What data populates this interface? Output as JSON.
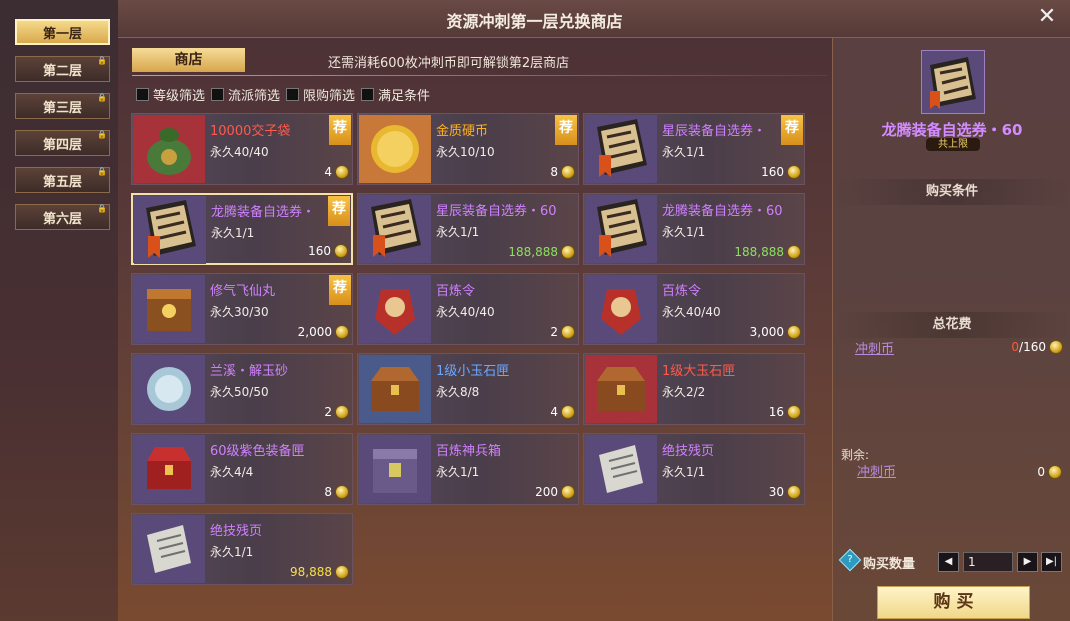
{
  "header": {
    "title": "资源冲刺第一层兑换商店",
    "close_icon": "✕"
  },
  "floors": [
    {
      "label": "第一层",
      "active": true,
      "locked": false
    },
    {
      "label": "第二层",
      "active": false,
      "locked": true
    },
    {
      "label": "第三层",
      "active": false,
      "locked": true
    },
    {
      "label": "第四层",
      "active": false,
      "locked": true
    },
    {
      "label": "第五层",
      "active": false,
      "locked": true
    },
    {
      "label": "第六层",
      "active": false,
      "locked": true
    }
  ],
  "shop": {
    "tab_label": "商店",
    "unlock_note": "还需消耗600枚冲刺币即可解锁第2层商店",
    "filters": [
      "等级筛选",
      "流派筛选",
      "限购筛选",
      "满足条件"
    ]
  },
  "recommend_label": "荐",
  "items": [
    {
      "name": "10000交子袋",
      "limit": "永久40/40",
      "price": "4",
      "name_color": "#ff5a4a",
      "recommended": true,
      "icon": "coin-bag-icon"
    },
    {
      "name": "金质硬币",
      "limit": "永久10/10",
      "price": "8",
      "name_color": "#ffb020",
      "recommended": true,
      "icon": "gold-coin-icon"
    },
    {
      "name": "星辰装备自选券・",
      "limit": "永久1/1",
      "price": "160",
      "name_color": "#d080ff",
      "recommended": true,
      "icon": "voucher-star-icon"
    },
    {
      "name": "龙腾装备自选券・",
      "limit": "永久1/1",
      "price": "160",
      "name_color": "#d080ff",
      "recommended": true,
      "icon": "voucher-dragon-icon",
      "selected": true
    },
    {
      "name": "星辰装备自选券・60",
      "limit": "永久1/1",
      "price": "188,888",
      "name_color": "#d080ff",
      "recommended": false,
      "icon": "voucher-star-icon",
      "price_color": "green"
    },
    {
      "name": "龙腾装备自选券・60",
      "limit": "永久1/1",
      "price": "188,888",
      "name_color": "#d080ff",
      "recommended": false,
      "icon": "voucher-dragon-icon",
      "price_color": "green"
    },
    {
      "name": "修气飞仙丸",
      "limit": "永久30/30",
      "price": "2,000",
      "name_color": "#d080ff",
      "recommended": true,
      "icon": "pill-box-icon"
    },
    {
      "name": "百炼令",
      "limit": "永久40/40",
      "price": "2",
      "name_color": "#d080ff",
      "recommended": false,
      "icon": "token-icon"
    },
    {
      "name": "百炼令",
      "limit": "永久40/40",
      "price": "3,000",
      "name_color": "#d080ff",
      "recommended": false,
      "icon": "token-icon"
    },
    {
      "name": "兰溪・解玉砂",
      "limit": "永久50/50",
      "price": "2",
      "name_color": "#d080ff",
      "recommended": false,
      "icon": "jade-sand-icon"
    },
    {
      "name": "1级小玉石匣",
      "limit": "永久8/8",
      "price": "4",
      "name_color": "#6aa8ff",
      "recommended": false,
      "icon": "jade-box-icon"
    },
    {
      "name": "1级大玉石匣",
      "limit": "永久2/2",
      "price": "16",
      "name_color": "#ff5a4a",
      "recommended": false,
      "icon": "jade-box-icon"
    },
    {
      "name": "60级紫色装备匣",
      "limit": "永久4/4",
      "price": "8",
      "name_color": "#d080ff",
      "recommended": false,
      "icon": "equip-box-icon"
    },
    {
      "name": "百炼神兵箱",
      "limit": "永久1/1",
      "price": "200",
      "name_color": "#d080ff",
      "recommended": false,
      "icon": "weapon-chest-icon"
    },
    {
      "name": "绝技残页",
      "limit": "永久1/1",
      "price": "30",
      "name_color": "#d080ff",
      "recommended": false,
      "icon": "scroll-page-icon"
    },
    {
      "name": "绝技残页",
      "limit": "永久1/1",
      "price": "98,888",
      "name_color": "#d080ff",
      "recommended": false,
      "icon": "scroll-page-icon",
      "price_color": "yellow"
    }
  ],
  "side": {
    "item_name": "龙腾装备自选券・60",
    "badge": "共上限",
    "condition_title": "购买条件",
    "total_title": "总花费",
    "currency": "冲刺币",
    "cost_current": "0",
    "cost_total": "/160",
    "remaining_label": "剩余:",
    "remaining_value": "0",
    "qty_label": "购买数量",
    "qty_value": "1",
    "buy_label": "购 买"
  }
}
